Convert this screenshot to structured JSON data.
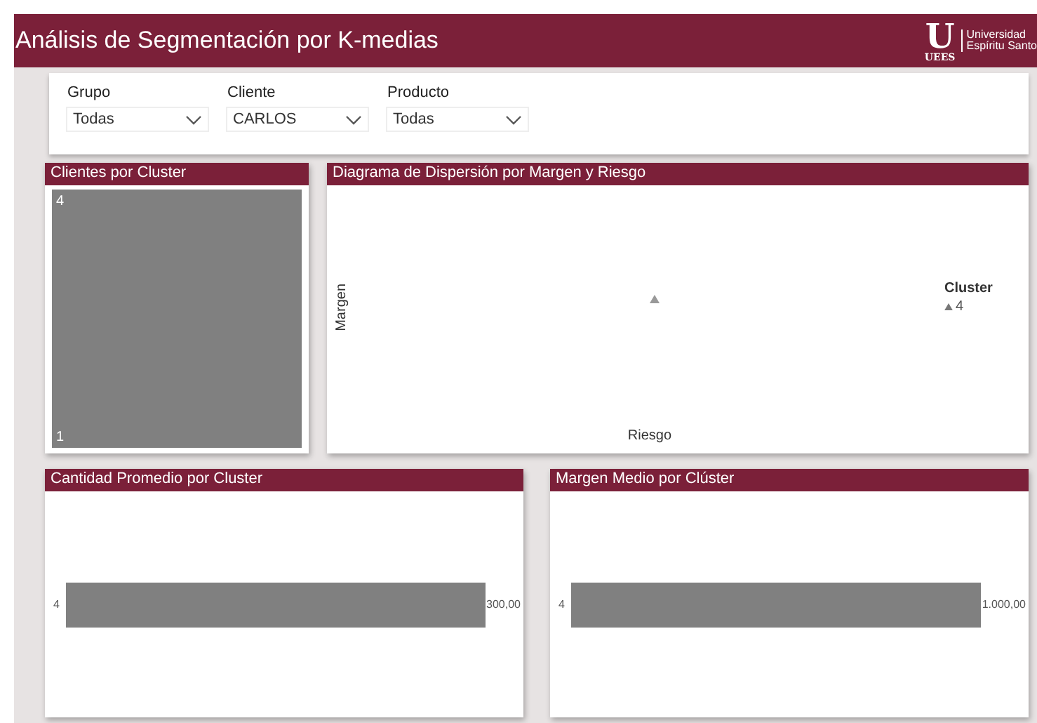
{
  "header": {
    "title": "Análisis de Segmentación por K-medias",
    "logo": {
      "mark": "U",
      "acronym": "UEES",
      "name_lines": [
        "Universidad",
        "Espíritu Santo"
      ]
    }
  },
  "filters": [
    {
      "label": "Grupo",
      "value": "Todas"
    },
    {
      "label": "Cliente",
      "value": "CARLOS"
    },
    {
      "label": "Producto",
      "value": "Todas"
    }
  ],
  "clients_by_cluster": {
    "title": "Clientes por Cluster",
    "tile_label": "4",
    "tile_value": "1"
  },
  "scatter": {
    "title": "Diagrama de Dispersión por Margen y Riesgo",
    "ylabel": "Margen",
    "xlabel": "Riesgo",
    "legend_title": "Cluster",
    "legend_items": [
      "4"
    ]
  },
  "avg_quantity": {
    "title": "Cantidad Promedio por Cluster",
    "bars": [
      {
        "category": "4",
        "value_label": "300,00"
      }
    ]
  },
  "avg_margin": {
    "title": "Margen Medio por Clúster",
    "bars": [
      {
        "category": "4",
        "value_label": "1.000,00"
      }
    ]
  }
}
